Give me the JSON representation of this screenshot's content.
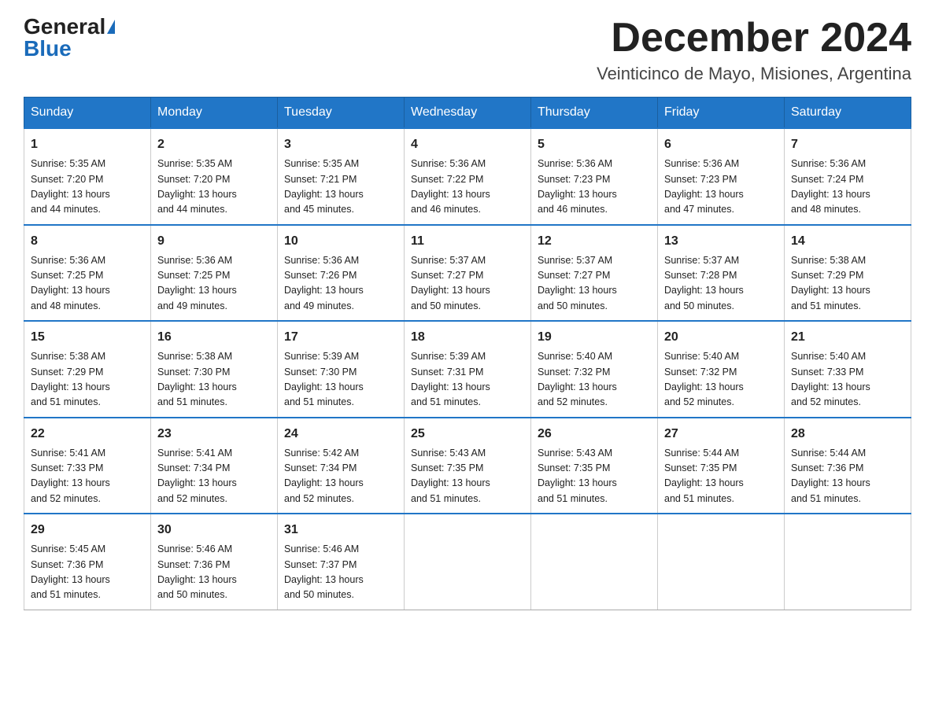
{
  "logo": {
    "general": "General",
    "blue": "Blue"
  },
  "title": "December 2024",
  "subtitle": "Veinticinco de Mayo, Misiones, Argentina",
  "headers": [
    "Sunday",
    "Monday",
    "Tuesday",
    "Wednesday",
    "Thursday",
    "Friday",
    "Saturday"
  ],
  "weeks": [
    [
      {
        "day": "1",
        "sunrise": "Sunrise: 5:35 AM",
        "sunset": "Sunset: 7:20 PM",
        "daylight": "Daylight: 13 hours",
        "daylight2": "and 44 minutes."
      },
      {
        "day": "2",
        "sunrise": "Sunrise: 5:35 AM",
        "sunset": "Sunset: 7:20 PM",
        "daylight": "Daylight: 13 hours",
        "daylight2": "and 44 minutes."
      },
      {
        "day": "3",
        "sunrise": "Sunrise: 5:35 AM",
        "sunset": "Sunset: 7:21 PM",
        "daylight": "Daylight: 13 hours",
        "daylight2": "and 45 minutes."
      },
      {
        "day": "4",
        "sunrise": "Sunrise: 5:36 AM",
        "sunset": "Sunset: 7:22 PM",
        "daylight": "Daylight: 13 hours",
        "daylight2": "and 46 minutes."
      },
      {
        "day": "5",
        "sunrise": "Sunrise: 5:36 AM",
        "sunset": "Sunset: 7:23 PM",
        "daylight": "Daylight: 13 hours",
        "daylight2": "and 46 minutes."
      },
      {
        "day": "6",
        "sunrise": "Sunrise: 5:36 AM",
        "sunset": "Sunset: 7:23 PM",
        "daylight": "Daylight: 13 hours",
        "daylight2": "and 47 minutes."
      },
      {
        "day": "7",
        "sunrise": "Sunrise: 5:36 AM",
        "sunset": "Sunset: 7:24 PM",
        "daylight": "Daylight: 13 hours",
        "daylight2": "and 48 minutes."
      }
    ],
    [
      {
        "day": "8",
        "sunrise": "Sunrise: 5:36 AM",
        "sunset": "Sunset: 7:25 PM",
        "daylight": "Daylight: 13 hours",
        "daylight2": "and 48 minutes."
      },
      {
        "day": "9",
        "sunrise": "Sunrise: 5:36 AM",
        "sunset": "Sunset: 7:25 PM",
        "daylight": "Daylight: 13 hours",
        "daylight2": "and 49 minutes."
      },
      {
        "day": "10",
        "sunrise": "Sunrise: 5:36 AM",
        "sunset": "Sunset: 7:26 PM",
        "daylight": "Daylight: 13 hours",
        "daylight2": "and 49 minutes."
      },
      {
        "day": "11",
        "sunrise": "Sunrise: 5:37 AM",
        "sunset": "Sunset: 7:27 PM",
        "daylight": "Daylight: 13 hours",
        "daylight2": "and 50 minutes."
      },
      {
        "day": "12",
        "sunrise": "Sunrise: 5:37 AM",
        "sunset": "Sunset: 7:27 PM",
        "daylight": "Daylight: 13 hours",
        "daylight2": "and 50 minutes."
      },
      {
        "day": "13",
        "sunrise": "Sunrise: 5:37 AM",
        "sunset": "Sunset: 7:28 PM",
        "daylight": "Daylight: 13 hours",
        "daylight2": "and 50 minutes."
      },
      {
        "day": "14",
        "sunrise": "Sunrise: 5:38 AM",
        "sunset": "Sunset: 7:29 PM",
        "daylight": "Daylight: 13 hours",
        "daylight2": "and 51 minutes."
      }
    ],
    [
      {
        "day": "15",
        "sunrise": "Sunrise: 5:38 AM",
        "sunset": "Sunset: 7:29 PM",
        "daylight": "Daylight: 13 hours",
        "daylight2": "and 51 minutes."
      },
      {
        "day": "16",
        "sunrise": "Sunrise: 5:38 AM",
        "sunset": "Sunset: 7:30 PM",
        "daylight": "Daylight: 13 hours",
        "daylight2": "and 51 minutes."
      },
      {
        "day": "17",
        "sunrise": "Sunrise: 5:39 AM",
        "sunset": "Sunset: 7:30 PM",
        "daylight": "Daylight: 13 hours",
        "daylight2": "and 51 minutes."
      },
      {
        "day": "18",
        "sunrise": "Sunrise: 5:39 AM",
        "sunset": "Sunset: 7:31 PM",
        "daylight": "Daylight: 13 hours",
        "daylight2": "and 51 minutes."
      },
      {
        "day": "19",
        "sunrise": "Sunrise: 5:40 AM",
        "sunset": "Sunset: 7:32 PM",
        "daylight": "Daylight: 13 hours",
        "daylight2": "and 52 minutes."
      },
      {
        "day": "20",
        "sunrise": "Sunrise: 5:40 AM",
        "sunset": "Sunset: 7:32 PM",
        "daylight": "Daylight: 13 hours",
        "daylight2": "and 52 minutes."
      },
      {
        "day": "21",
        "sunrise": "Sunrise: 5:40 AM",
        "sunset": "Sunset: 7:33 PM",
        "daylight": "Daylight: 13 hours",
        "daylight2": "and 52 minutes."
      }
    ],
    [
      {
        "day": "22",
        "sunrise": "Sunrise: 5:41 AM",
        "sunset": "Sunset: 7:33 PM",
        "daylight": "Daylight: 13 hours",
        "daylight2": "and 52 minutes."
      },
      {
        "day": "23",
        "sunrise": "Sunrise: 5:41 AM",
        "sunset": "Sunset: 7:34 PM",
        "daylight": "Daylight: 13 hours",
        "daylight2": "and 52 minutes."
      },
      {
        "day": "24",
        "sunrise": "Sunrise: 5:42 AM",
        "sunset": "Sunset: 7:34 PM",
        "daylight": "Daylight: 13 hours",
        "daylight2": "and 52 minutes."
      },
      {
        "day": "25",
        "sunrise": "Sunrise: 5:43 AM",
        "sunset": "Sunset: 7:35 PM",
        "daylight": "Daylight: 13 hours",
        "daylight2": "and 51 minutes."
      },
      {
        "day": "26",
        "sunrise": "Sunrise: 5:43 AM",
        "sunset": "Sunset: 7:35 PM",
        "daylight": "Daylight: 13 hours",
        "daylight2": "and 51 minutes."
      },
      {
        "day": "27",
        "sunrise": "Sunrise: 5:44 AM",
        "sunset": "Sunset: 7:35 PM",
        "daylight": "Daylight: 13 hours",
        "daylight2": "and 51 minutes."
      },
      {
        "day": "28",
        "sunrise": "Sunrise: 5:44 AM",
        "sunset": "Sunset: 7:36 PM",
        "daylight": "Daylight: 13 hours",
        "daylight2": "and 51 minutes."
      }
    ],
    [
      {
        "day": "29",
        "sunrise": "Sunrise: 5:45 AM",
        "sunset": "Sunset: 7:36 PM",
        "daylight": "Daylight: 13 hours",
        "daylight2": "and 51 minutes."
      },
      {
        "day": "30",
        "sunrise": "Sunrise: 5:46 AM",
        "sunset": "Sunset: 7:36 PM",
        "daylight": "Daylight: 13 hours",
        "daylight2": "and 50 minutes."
      },
      {
        "day": "31",
        "sunrise": "Sunrise: 5:46 AM",
        "sunset": "Sunset: 7:37 PM",
        "daylight": "Daylight: 13 hours",
        "daylight2": "and 50 minutes."
      },
      null,
      null,
      null,
      null
    ]
  ]
}
